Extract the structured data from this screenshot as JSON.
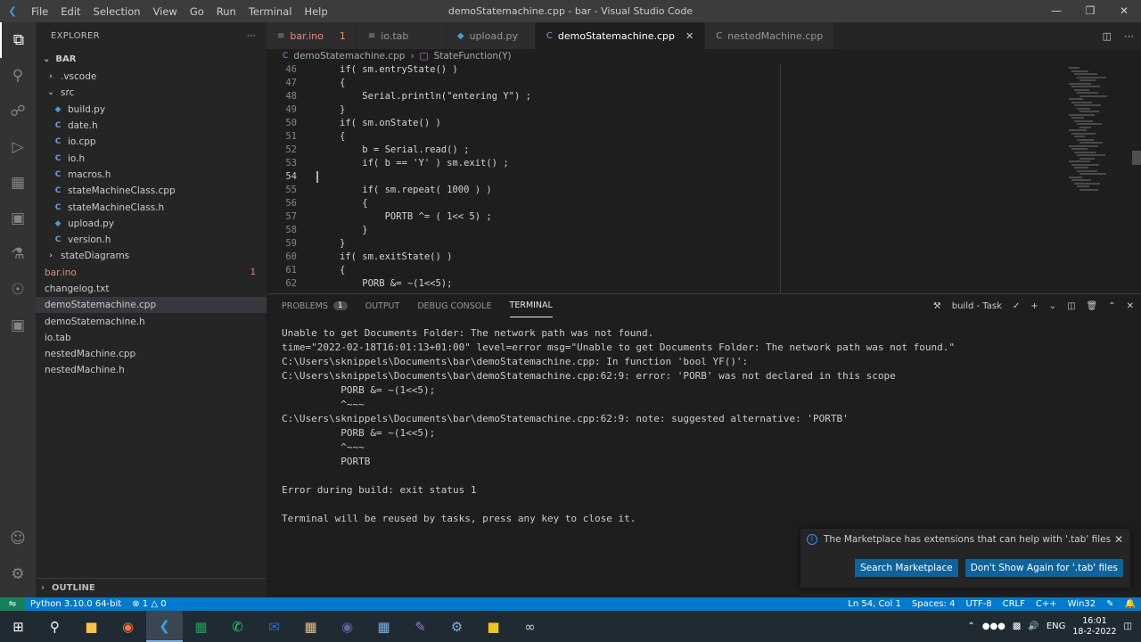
{
  "window": {
    "title": "demoStatemachine.cpp - bar - Visual Studio Code",
    "menu": [
      "File",
      "Edit",
      "Selection",
      "View",
      "Go",
      "Run",
      "Terminal",
      "Help"
    ]
  },
  "sidebar": {
    "header": "EXPLORER",
    "folder": "BAR",
    "items": [
      {
        "label": ".vscode",
        "icon": "chevron-right",
        "indent": 1
      },
      {
        "label": "src",
        "icon": "chevron-down",
        "indent": 1
      },
      {
        "label": "build.py",
        "icon": "python-file",
        "indent": 2
      },
      {
        "label": "date.h",
        "icon": "c-file",
        "indent": 2
      },
      {
        "label": "io.cpp",
        "icon": "c-file",
        "indent": 2
      },
      {
        "label": "io.h",
        "icon": "c-file",
        "indent": 2
      },
      {
        "label": "macros.h",
        "icon": "c-file",
        "indent": 2
      },
      {
        "label": "stateMachineClass.cpp",
        "icon": "c-file",
        "indent": 2
      },
      {
        "label": "stateMachineClass.h",
        "icon": "c-file",
        "indent": 2
      },
      {
        "label": "upload.py",
        "icon": "python-file",
        "indent": 2
      },
      {
        "label": "version.h",
        "icon": "c-file",
        "indent": 2
      },
      {
        "label": "stateDiagrams",
        "icon": "chevron-right",
        "indent": 1
      },
      {
        "label": "bar.ino",
        "icon": "none",
        "indent": 1,
        "error": true,
        "badge": "1"
      },
      {
        "label": "changelog.txt",
        "icon": "none",
        "indent": 1
      },
      {
        "label": "demoStatemachine.cpp",
        "icon": "none",
        "indent": 1,
        "selected": true
      },
      {
        "label": "demoStatemachine.h",
        "icon": "none",
        "indent": 1
      },
      {
        "label": "io.tab",
        "icon": "none",
        "indent": 1
      },
      {
        "label": "nestedMachine.cpp",
        "icon": "none",
        "indent": 1
      },
      {
        "label": "nestedMachine.h",
        "icon": "none",
        "indent": 1
      }
    ],
    "outline": "OUTLINE"
  },
  "tabs": [
    {
      "label": "bar.ino",
      "count": "1",
      "error": true
    },
    {
      "label": "io.tab"
    },
    {
      "label": "upload.py"
    },
    {
      "label": "demoStatemachine.cpp",
      "active": true
    },
    {
      "label": "nestedMachine.cpp"
    }
  ],
  "breadcrumb": {
    "file": "demoStatemachine.cpp",
    "symbol": "StateFunction(Y)"
  },
  "code": [
    {
      "n": "46",
      "t": "if( sm.entryState() )"
    },
    {
      "n": "47",
      "t": "{"
    },
    {
      "n": "48",
      "t": "    Serial.println(\"entering Y\") ;"
    },
    {
      "n": "49",
      "t": "}"
    },
    {
      "n": "50",
      "t": "if( sm.onState() )"
    },
    {
      "n": "51",
      "t": "{"
    },
    {
      "n": "52",
      "t": "    b = Serial.read() ;"
    },
    {
      "n": "53",
      "t": "    if( b == 'Y' ) sm.exit() ;"
    },
    {
      "n": "54",
      "t": ""
    },
    {
      "n": "55",
      "t": "    if( sm.repeat( 1000 ) )"
    },
    {
      "n": "56",
      "t": "    {"
    },
    {
      "n": "57",
      "t": "        PORTB ^= ( 1<< 5) ;"
    },
    {
      "n": "58",
      "t": "    }"
    },
    {
      "n": "59",
      "t": "}"
    },
    {
      "n": "60",
      "t": "if( sm.exitState() )"
    },
    {
      "n": "61",
      "t": "{"
    },
    {
      "n": "62",
      "t": "    PORB &= ~(1<<5);"
    }
  ],
  "panel": {
    "tabs": [
      "PROBLEMS",
      "OUTPUT",
      "DEBUG CONSOLE",
      "TERMINAL"
    ],
    "problems_count": "1",
    "task_label": "build - Task"
  },
  "terminal": [
    "Unable to get Documents Folder: The network path was not found.",
    "time=\"2022-02-18T16:01:13+01:00\" level=error msg=\"Unable to get Documents Folder: The network path was not found.\"",
    "C:\\Users\\sknippels\\Documents\\bar\\demoStatemachine.cpp: In function 'bool YF()':",
    "C:\\Users\\sknippels\\Documents\\bar\\demoStatemachine.cpp:62:9: error: 'PORB' was not declared in this scope",
    "          PORB &= ~(1<<5);",
    "          ^~~~",
    "C:\\Users\\sknippels\\Documents\\bar\\demoStatemachine.cpp:62:9: note: suggested alternative: 'PORTB'",
    "          PORB &= ~(1<<5);",
    "          ^~~~",
    "          PORTB",
    "",
    "Error during build: exit status 1",
    "",
    "Terminal will be reused by tasks, press any key to close it."
  ],
  "notification": {
    "message": "The Marketplace has extensions that can help with '.tab' files",
    "primary": "Search Marketplace",
    "secondary": "Don't Show Again for '.tab' files"
  },
  "status": {
    "python": "Python 3.10.0 64-bit",
    "errors": "1",
    "warnings": "0",
    "position": "Ln 54, Col 1",
    "spaces": "Spaces: 4",
    "encoding": "UTF-8",
    "eol": "CRLF",
    "language": "C++",
    "platform": "Win32"
  },
  "taskbar": {
    "lang": "ENG",
    "time": "16:01",
    "date": "18-2-2022"
  }
}
